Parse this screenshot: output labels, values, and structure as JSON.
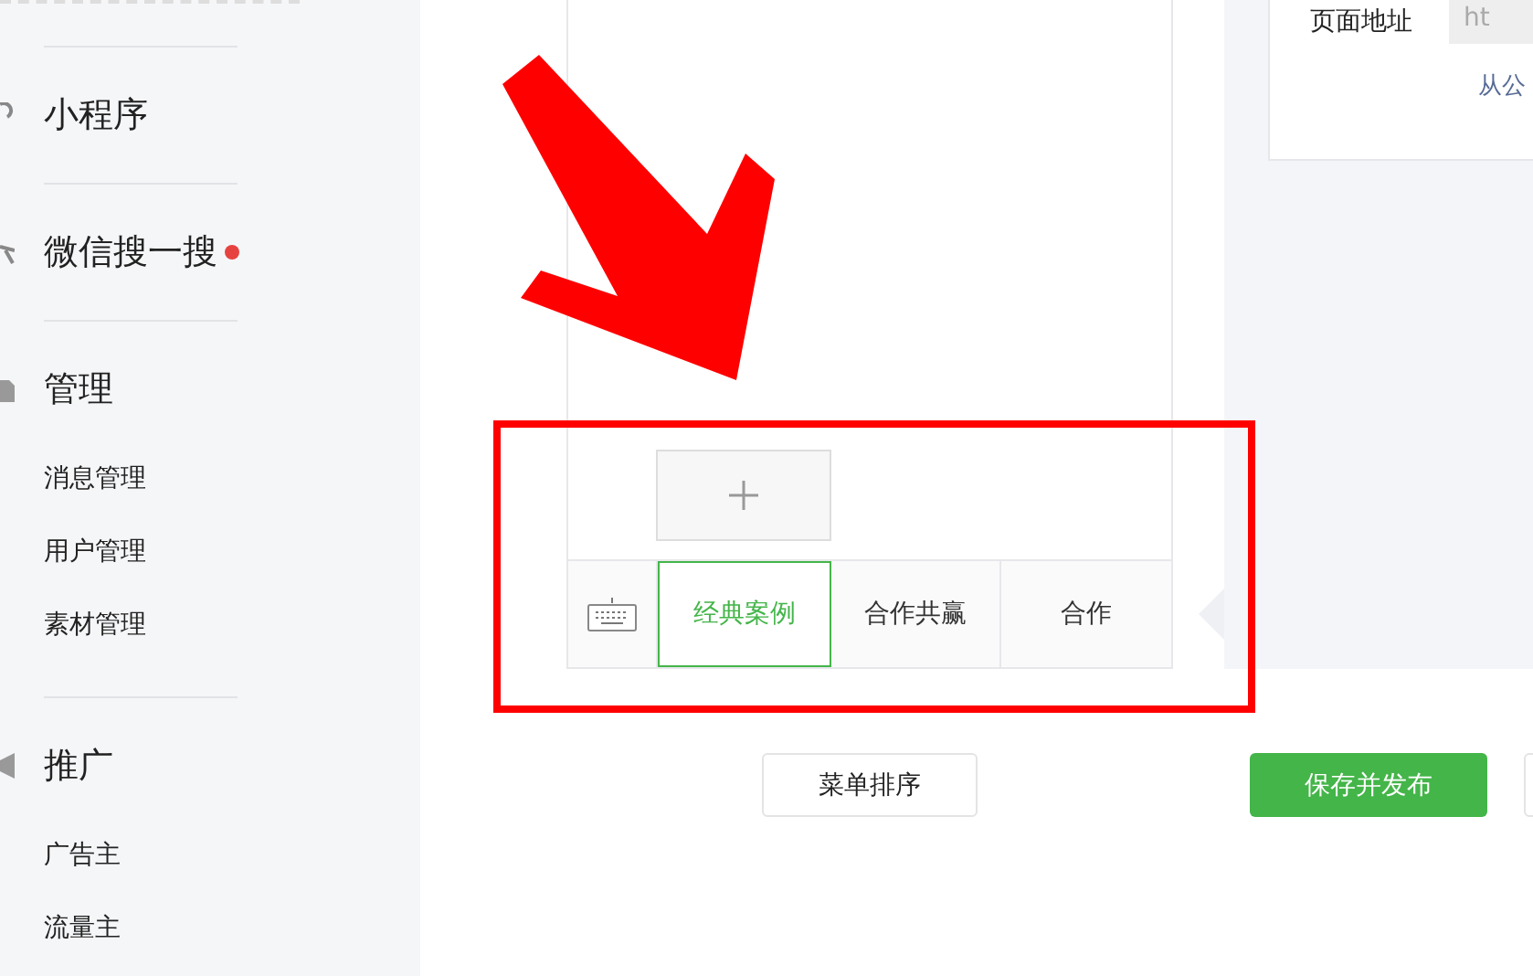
{
  "sidebar": {
    "sections": [
      {
        "title": "小程序",
        "dot": false
      },
      {
        "title": "微信搜一搜",
        "dot": true
      },
      {
        "title": "管理",
        "dot": false,
        "items": [
          "消息管理",
          "用户管理",
          "素材管理"
        ]
      },
      {
        "title": "推广",
        "dot": false,
        "items": [
          "广告主",
          "流量主"
        ]
      }
    ]
  },
  "menu_editor": {
    "tabs": [
      {
        "label": "经典案例",
        "selected": true
      },
      {
        "label": "合作共赢",
        "selected": false
      },
      {
        "label": "合作",
        "selected": false
      }
    ]
  },
  "settings_card": {
    "label": "页面地址",
    "field_value": "ht",
    "link": "从公"
  },
  "buttons": [
    {
      "label": "菜单排序",
      "kind": "default"
    },
    {
      "label": "保存并发布",
      "kind": "primary"
    },
    {
      "kind": "cut"
    }
  ]
}
